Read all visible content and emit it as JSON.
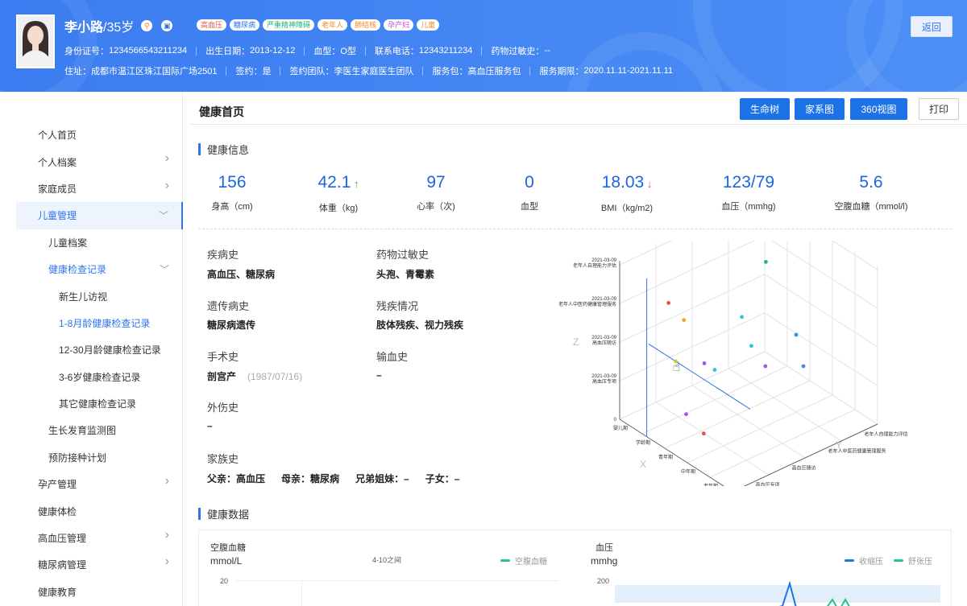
{
  "patient": {
    "name": "李小路",
    "age": "/35岁",
    "icon_a": "key-icon",
    "icon_b": "id-card-icon",
    "tags": [
      {
        "label": "高血压",
        "color": "#e8504f"
      },
      {
        "label": "糖尿病",
        "color": "#2e73f0"
      },
      {
        "label": "严重精神障碍",
        "color": "#22b37a"
      },
      {
        "label": "老年人",
        "color": "#f08a24"
      },
      {
        "label": "肺结核",
        "color": "#f08a24"
      },
      {
        "label": "孕产妇",
        "color": "#c04de0"
      },
      {
        "label": "儿童",
        "color": "#f08a24"
      }
    ],
    "row1": [
      {
        "label": "身份证号：",
        "value": "1234566543211234"
      },
      {
        "label": "出生日期：",
        "value": "2013-12-12"
      },
      {
        "label": "血型：",
        "value": "O型"
      },
      {
        "label": "联系电话：",
        "value": "12343211234"
      },
      {
        "label": "药物过敏史：",
        "value": "--"
      }
    ],
    "row2": [
      {
        "label": "住址：",
        "value": "成都市温江区珠江国际广场2501"
      },
      {
        "label": "签约：",
        "value": "是"
      },
      {
        "label": "签约团队：",
        "value": "李医生家庭医生团队"
      },
      {
        "label": "服务包：",
        "value": "高血压服务包"
      },
      {
        "label": "服务期限：",
        "value": "2020.11.11-2021.11.11"
      }
    ],
    "back_label": "返回"
  },
  "sidebar": {
    "items": [
      {
        "label": "个人首页",
        "level": 0,
        "chevron": ""
      },
      {
        "label": "个人档案",
        "level": 0,
        "chevron": "right"
      },
      {
        "label": "家庭成员",
        "level": 0,
        "chevron": "right"
      },
      {
        "label": "儿童管理",
        "level": 0,
        "chevron": "down",
        "state": "active"
      },
      {
        "label": "儿童档案",
        "level": 1,
        "chevron": ""
      },
      {
        "label": "健康检查记录",
        "level": 1,
        "chevron": "down",
        "state": "selected"
      },
      {
        "label": "新生儿访视",
        "level": 2,
        "chevron": ""
      },
      {
        "label": "1-8月龄健康检查记录",
        "level": 2,
        "chevron": "",
        "state": "selected"
      },
      {
        "label": "12-30月龄健康检查记录",
        "level": 2,
        "chevron": ""
      },
      {
        "label": "3-6岁健康检查记录",
        "level": 2,
        "chevron": ""
      },
      {
        "label": "其它健康检查记录",
        "level": 2,
        "chevron": ""
      },
      {
        "label": "生长发育监测图",
        "level": 1,
        "chevron": ""
      },
      {
        "label": "预防接种计划",
        "level": 1,
        "chevron": ""
      },
      {
        "label": "孕产管理",
        "level": 0,
        "chevron": "right"
      },
      {
        "label": "健康体检",
        "level": 0,
        "chevron": ""
      },
      {
        "label": "高血压管理",
        "level": 0,
        "chevron": "right"
      },
      {
        "label": "糖尿病管理",
        "level": 0,
        "chevron": "right"
      },
      {
        "label": "健康教育",
        "level": 0,
        "chevron": ""
      }
    ]
  },
  "main": {
    "title": "健康首页",
    "buttons": {
      "life_tree": "生命树",
      "family_tree": "家系图",
      "view360": "360视图",
      "print": "打印"
    },
    "health_info_title": "健康信息",
    "metrics": [
      {
        "value": "156",
        "label": "身高（cm)",
        "trend": ""
      },
      {
        "value": "42.1",
        "label": "体重（kg)",
        "trend": "up"
      },
      {
        "value": "97",
        "label": "心率（次)",
        "trend": ""
      },
      {
        "value": "0",
        "label": "血型",
        "trend": ""
      },
      {
        "value": "18.03",
        "label": "BMI（kg/m2)",
        "trend": "down"
      },
      {
        "value": "123/79",
        "label": "血压（mmhg)",
        "trend": ""
      },
      {
        "value": "5.6",
        "label": "空腹血糖（mmol/l)",
        "trend": ""
      }
    ],
    "history": {
      "disease_label": "疾病史",
      "disease_value": "高血压、糖尿病",
      "allergy_label": "药物过敏史",
      "allergy_value": "头孢、青霉素",
      "genetic_label": "遗传病史",
      "genetic_value": "糖尿病遗传",
      "disability_label": "残疾情况",
      "disability_value": "肢体残疾、视力残疾",
      "surgery_label": "手术史",
      "surgery_value": "剖宫产",
      "surgery_date": "(1987/07/16)",
      "transfusion_label": "输血史",
      "transfusion_value": "–",
      "trauma_label": "外伤史",
      "trauma_value": "–",
      "family_label": "家族史",
      "family": [
        {
          "label": "父亲：",
          "value": "高血压"
        },
        {
          "label": "母亲：",
          "value": "糖尿病"
        },
        {
          "label": "兄弟姐妹：",
          "value": "–"
        },
        {
          "label": "子女：",
          "value": "–"
        }
      ]
    },
    "health_data_title": "健康数据"
  },
  "chart_data": [
    {
      "type": "scatter",
      "title": "",
      "xlabel": "X",
      "ylabel": "Y",
      "zlabel": "Z",
      "x_categories": [
        "婴儿期",
        "学龄期",
        "青年期",
        "中年期",
        "老年期"
      ],
      "y_categories": [
        "高血压专项",
        "高血压随访",
        "老年人中医药健康管理服务",
        "老年人自理能力评估"
      ],
      "z_ticks": [
        {
          "value": 0,
          "label": "0"
        },
        {
          "value": 1,
          "label": "2021-03-09",
          "sub": "高血压专项"
        },
        {
          "value": 2,
          "label": "2021-03-09",
          "sub": "高血压随访"
        },
        {
          "value": 3,
          "label": "2021-03-09",
          "sub": "老年人中医药健康管理服务"
        },
        {
          "value": 4,
          "label": "2021-03-09",
          "sub": "老年人自理能力评估"
        }
      ],
      "points": [
        {
          "x": 1.2,
          "y": 0.6,
          "z": 3.2,
          "color": "#e8504f"
        },
        {
          "x": 1.4,
          "y": 0.9,
          "z": 2.7,
          "color": "#f0a030"
        },
        {
          "x": 1.2,
          "y": 0.8,
          "z": 1.6,
          "color": "#b8d22e"
        },
        {
          "x": 1.5,
          "y": 1.4,
          "z": 1.4,
          "color": "#a556e8"
        },
        {
          "x": 1.8,
          "y": 1.5,
          "z": 1.3,
          "color": "#2bc5d6"
        },
        {
          "x": 2.6,
          "y": 2.4,
          "z": 1.3,
          "color": "#a556e8"
        },
        {
          "x": 2.3,
          "y": 2.2,
          "z": 1.8,
          "color": "#2bc5d6"
        },
        {
          "x": 2.2,
          "y": 2.0,
          "z": 2.6,
          "color": "#2bc5d6"
        },
        {
          "x": 2.3,
          "y": 2.6,
          "z": 3.8,
          "color": "#22b37a"
        },
        {
          "x": 3.0,
          "y": 3.0,
          "z": 2.0,
          "color": "#3b8de8"
        },
        {
          "x": 3.0,
          "y": 3.2,
          "z": 1.1,
          "color": "#3b8de8"
        },
        {
          "x": 1.5,
          "y": 0.9,
          "z": 0.3,
          "color": "#a556e8"
        },
        {
          "x": 2.6,
          "y": 0.7,
          "z": 0.3,
          "color": "#e8504f"
        }
      ]
    },
    {
      "type": "line",
      "title": "空腹血糖",
      "ylabel": "mmol/L",
      "note": "4-10之间",
      "ytick_top": "20",
      "series": [
        {
          "name": "空腹血糖",
          "color": "#22c38e"
        }
      ]
    },
    {
      "type": "line",
      "title": "血压",
      "ylabel": "mmhg",
      "ytick_top": "200",
      "series": [
        {
          "name": "收缩压",
          "color": "#1e72e8"
        },
        {
          "name": "舒张压",
          "color": "#22c38e"
        }
      ]
    }
  ]
}
